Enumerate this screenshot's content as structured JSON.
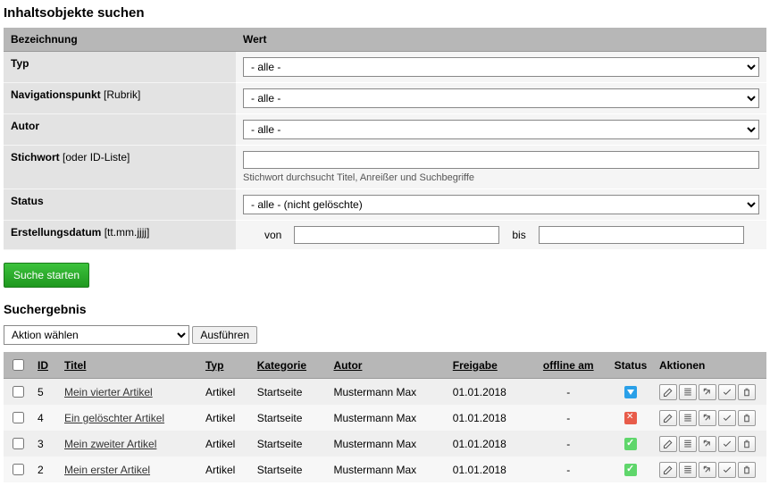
{
  "page": {
    "title": "Inhaltsobjekte suchen",
    "results_title": "Suchergebnis"
  },
  "filter": {
    "header_label": "Bezeichnung",
    "header_value": "Wert",
    "rows": {
      "typ": {
        "label": "Typ",
        "value": "- alle -"
      },
      "nav": {
        "label": "Navigationspunkt",
        "sub": " [Rubrik]",
        "value": "- alle -"
      },
      "autor": {
        "label": "Autor",
        "value": "- alle -"
      },
      "stichwort": {
        "label": "Stichwort",
        "sub": " [oder ID-Liste]",
        "value": "",
        "hint": "Stichwort durchsucht Titel, Anreißer und Suchbegriffe"
      },
      "status": {
        "label": "Status",
        "value": "- alle - (nicht gelöschte)"
      },
      "erstellung": {
        "label": "Erstellungsdatum",
        "sub": " [tt.mm.jjjj]",
        "von_label": "von",
        "bis_label": "bis",
        "von": "",
        "bis": ""
      }
    },
    "submit": "Suche starten"
  },
  "batch": {
    "select": "Aktion wählen",
    "button": "Ausführen"
  },
  "results": {
    "headers": {
      "id": "ID",
      "titel": "Titel",
      "typ": "Typ",
      "kategorie": "Kategorie",
      "autor": "Autor",
      "freigabe": "Freigabe",
      "offline": "offline am",
      "status": "Status",
      "aktionen": "Aktionen"
    },
    "rows": [
      {
        "id": "5",
        "titel": "Mein vierter Artikel",
        "typ": "Artikel",
        "kategorie": "Startseite",
        "autor": "Mustermann Max",
        "freigabe": "01.01.2018",
        "offline": "-",
        "status": "blue"
      },
      {
        "id": "4",
        "titel": "Ein gelöschter Artikel",
        "typ": "Artikel",
        "kategorie": "Startseite",
        "autor": "Mustermann Max",
        "freigabe": "01.01.2018",
        "offline": "-",
        "status": "red"
      },
      {
        "id": "3",
        "titel": "Mein zweiter Artikel",
        "typ": "Artikel",
        "kategorie": "Startseite",
        "autor": "Mustermann Max",
        "freigabe": "01.01.2018",
        "offline": "-",
        "status": "green"
      },
      {
        "id": "2",
        "titel": "Mein erster Artikel",
        "typ": "Artikel",
        "kategorie": "Startseite",
        "autor": "Mustermann Max",
        "freigabe": "01.01.2018",
        "offline": "-",
        "status": "green"
      }
    ]
  }
}
